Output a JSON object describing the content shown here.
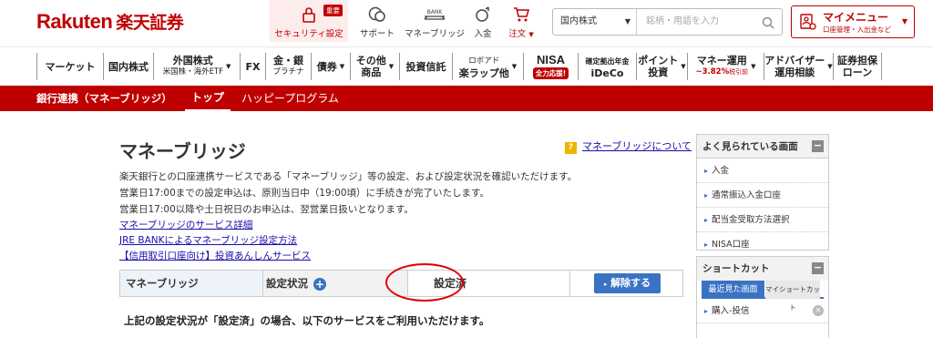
{
  "header": {
    "logo_en": "Rakuten",
    "logo_jp": "楽天証券",
    "nav": [
      {
        "label": "セキュリティ設定",
        "icon": "lock-icon",
        "badge": "重要"
      },
      {
        "label": "サポート",
        "icon": "support-icon"
      },
      {
        "label": "マネーブリッジ",
        "icon": "bank-icon",
        "icon_text": "BANK"
      },
      {
        "label": "入金",
        "icon": "deposit-icon"
      },
      {
        "label": "注文",
        "icon": "cart-icon"
      }
    ],
    "search": {
      "market": "国内株式",
      "placeholder": "銘柄・用語を入力"
    },
    "mymenu": {
      "title": "マイメニュー",
      "sub": "口座管理・入出金など"
    }
  },
  "mainnav": [
    {
      "label": "マーケット"
    },
    {
      "label": "国内株式"
    },
    {
      "label": "外国株式",
      "sub": "米国株・海外ETF",
      "caret": true
    },
    {
      "label": "FX"
    },
    {
      "label": "金・銀",
      "sub": "プラチナ"
    },
    {
      "label": "債券",
      "caret": true
    },
    {
      "label": "その他",
      "sub": "商品",
      "caret": true
    },
    {
      "label": "投資信託"
    },
    {
      "label": "ロボアド",
      "sub": "楽ラップ他",
      "caret": true
    },
    {
      "label": "NISA",
      "sub": "全力応援!"
    },
    {
      "label": "確定拠出年金",
      "sub": "iDeCo"
    },
    {
      "label": "ポイント",
      "sub": "投資",
      "caret": true
    },
    {
      "label": "マネー運用",
      "sub": "~3.82%",
      "sub2": "税引前",
      "caret": true
    },
    {
      "label": "アドバイザー",
      "sub": "運用相談",
      "caret": true
    },
    {
      "label": "証券担保",
      "sub": "ローン"
    }
  ],
  "subbar": {
    "section": "銀行連携（マネーブリッジ）",
    "tab_active": "トップ",
    "tab_other": "ハッピープログラム"
  },
  "content": {
    "title": "マネーブリッジ",
    "about_link": "マネーブリッジについて",
    "desc": [
      "楽天銀行との口座連携サービスである「マネーブリッジ」等の設定、および設定状況を確認いただけます。",
      "営業日17:00までの設定申込は、原則当日中（19:00頃）に手続きが完了いたします。",
      "営業日17:00以降や土日祝日のお申込は、翌営業日扱いとなります。"
    ],
    "links": [
      "マネーブリッジのサービス詳細",
      "JRE BANKによるマネーブリッジ設定方法",
      "【信用取引口座向け】投資あんしんサービス"
    ],
    "status_table": {
      "name": "マネーブリッジ",
      "status_label": "設定状況",
      "status_value": "設定済",
      "button": "解除する"
    },
    "note": "上記の設定状況が「設定済」の場合、以下のサービスをご利用いただけます。"
  },
  "sidebar": {
    "popular": {
      "title": "よく見られている画面",
      "items": [
        "入金",
        "通常振込入金口座",
        "配当金受取方法選択",
        "NISA口座"
      ]
    },
    "shortcut": {
      "title": "ショートカット",
      "tab_active": "最近見た画面",
      "tab_other": "マイショートカット",
      "items": [
        "購入-投信"
      ]
    }
  }
}
